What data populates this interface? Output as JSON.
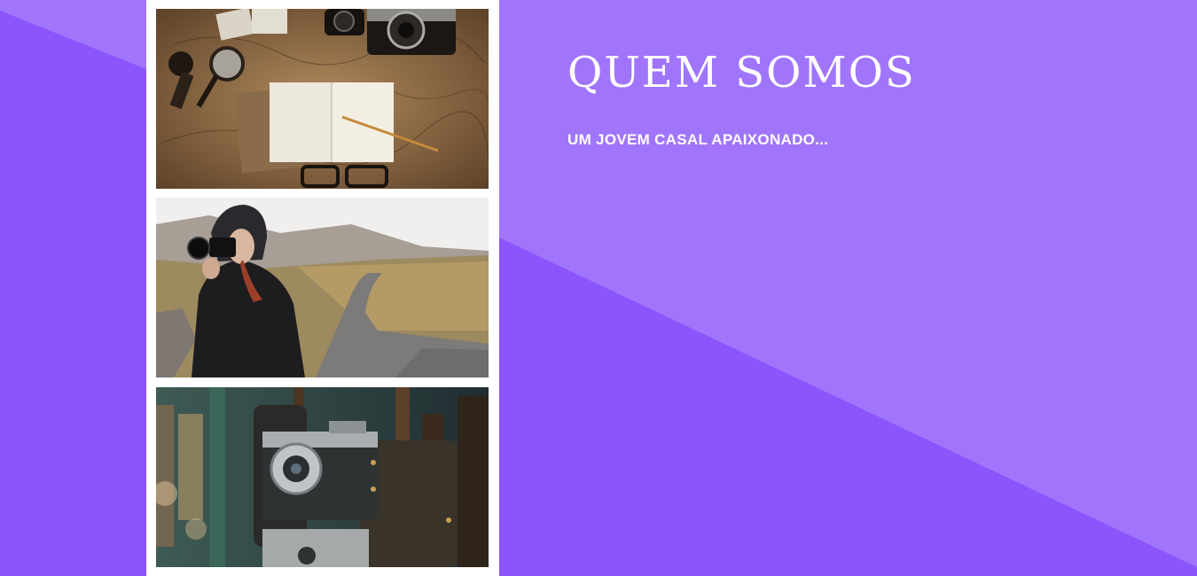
{
  "colors": {
    "background_light": "#a075fc",
    "background_dark": "#8c55fb",
    "panel": "#ffffff",
    "text": "#ffffff"
  },
  "about": {
    "title": "QUEM SOMOS",
    "subtitle": "UM JOVEM CASAL APAIXONADO..."
  },
  "gallery": {
    "photos": [
      {
        "subject": "map-notebook-travel-photo"
      },
      {
        "subject": "woman-photographer-photo"
      },
      {
        "subject": "vintage-camera-photo"
      }
    ]
  }
}
